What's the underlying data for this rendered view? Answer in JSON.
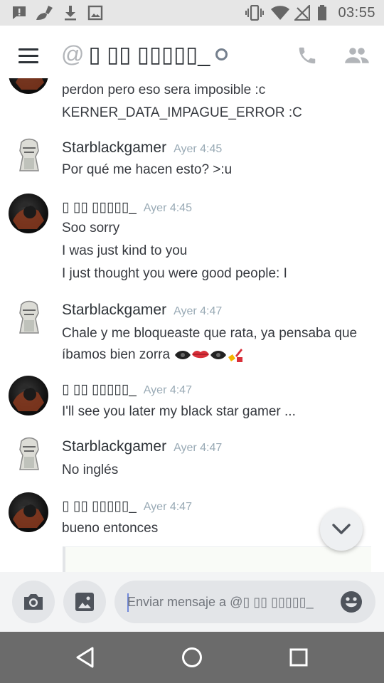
{
  "status_bar": {
    "time": "03:55",
    "left_icons": [
      "message-alert-icon",
      "broom-icon",
      "download-icon",
      "image-icon"
    ],
    "right_icons": [
      "vibrate-icon",
      "wifi-icon",
      "no-signal-icon",
      "battery-icon"
    ]
  },
  "header": {
    "at_symbol": "@",
    "channel_name": "▯ ▯▯ ▯▯▯▯▯_",
    "icons": [
      "menu-icon",
      "phone-icon",
      "members-icon"
    ]
  },
  "messages": [
    {
      "author": "",
      "timestamp": "",
      "avatar": "dark",
      "lines": [
        "perdon pero eso sera imposible :c",
        "KERNER_DATA_IMPAGUE_ERROR :C"
      ]
    },
    {
      "author": "Starblackgamer",
      "timestamp": "Ayer 4:45",
      "avatar": "light",
      "lines": [
        "Por qué me hacen esto? >:u"
      ]
    },
    {
      "author": "▯ ▯▯ ▯▯▯▯▯_",
      "timestamp": "Ayer 4:45",
      "avatar": "dark",
      "lines": [
        "Soo sorry",
        "I was just kind to you",
        "I just thought you were good people: I"
      ]
    },
    {
      "author": "Starblackgamer",
      "timestamp": "Ayer 4:47",
      "avatar": "light",
      "lines": [
        "Chale y me bloqueaste que rata, ya pensaba que",
        "íbamos bien zorra"
      ],
      "emoji": [
        "eye-emoji",
        "lips-emoji",
        "eye-emoji",
        "nail-polish-emoji"
      ]
    },
    {
      "author": "▯ ▯▯ ▯▯▯▯▯_",
      "timestamp": "Ayer 4:47",
      "avatar": "dark",
      "lines": [
        "I'll see you later my black star gamer ..."
      ]
    },
    {
      "author": "Starblackgamer",
      "timestamp": "Ayer 4:47",
      "avatar": "light",
      "lines": [
        "No inglés"
      ]
    },
    {
      "author": "▯ ▯▯ ▯▯▯▯▯_",
      "timestamp": "Ayer 4:47",
      "avatar": "dark",
      "lines": [
        "bueno entonces"
      ]
    }
  ],
  "jump_button": {
    "icon": "chevron-down-icon"
  },
  "composer": {
    "placeholder": "Enviar mensaje a @▯ ▯▯ ▯▯▯▯▯_",
    "value": "",
    "icons": [
      "camera-icon",
      "gallery-icon",
      "emoji-icon"
    ]
  },
  "nav_bar": {
    "icons": [
      "back-icon",
      "home-icon",
      "recents-icon"
    ]
  },
  "colors": {
    "status_bar_bg": "#e6e6e6",
    "nav_bar_bg": "#6b6b6b",
    "text_primary": "#36393f",
    "timestamp": "#99aab5",
    "icon_gray": "#b2b5b9",
    "composer_bg": "#f3f4f5",
    "pill_bg": "#e3e5e8"
  }
}
